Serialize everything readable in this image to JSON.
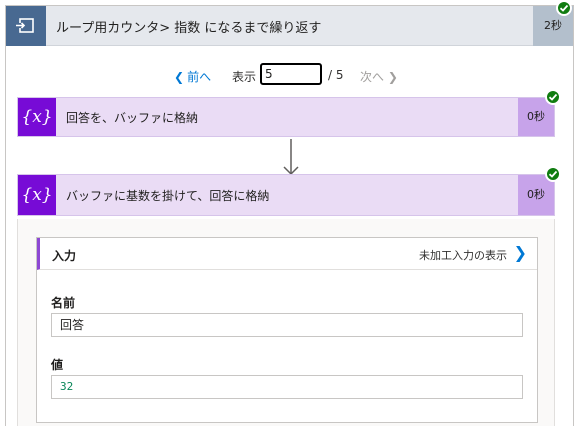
{
  "loop": {
    "title": "ループ用カウンタ> 指数 になるまで繰り返す",
    "duration": "2秒",
    "icon": "loop-icon"
  },
  "pager": {
    "prev_label": "前へ",
    "show_label": "表示",
    "current_value": "5",
    "total": "/ 5",
    "next_label": "次へ"
  },
  "actions": [
    {
      "title": "回答を、バッファに格納",
      "duration": "0秒",
      "icon": "variable-icon",
      "icon_glyph": "{𝑥}"
    },
    {
      "title": "バッファに基数を掛けて、回答に格納",
      "duration": "0秒",
      "icon": "variable-icon",
      "icon_glyph": "{𝑥}"
    }
  ],
  "inputs": {
    "title": "入力",
    "raw_link": "未加工入力の表示",
    "fields": [
      {
        "label": "名前",
        "value": "回答"
      },
      {
        "label": "値",
        "value": "32"
      }
    ]
  },
  "colors": {
    "loop_header": "#e5e8ed",
    "loop_icon": "#486991",
    "variable_purple": "#770bd6",
    "action_bg": "#eadcf5",
    "success_green": "#107c10",
    "link_blue": "#0078d4"
  }
}
